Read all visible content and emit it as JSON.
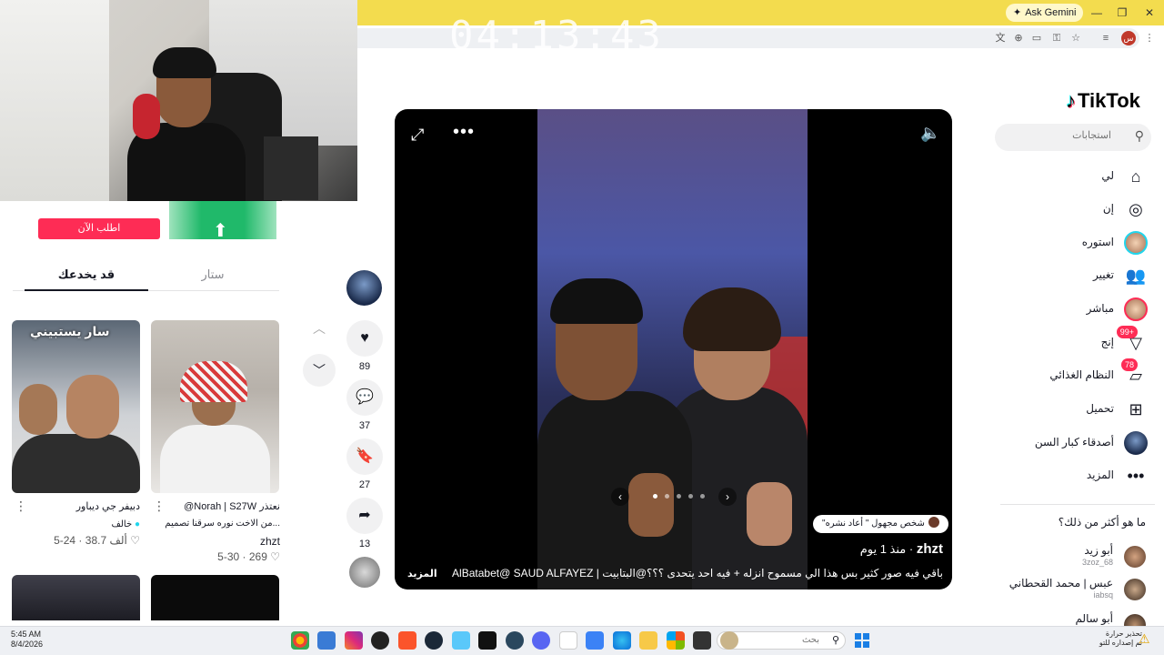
{
  "overlay": {
    "timer": "04:13:43"
  },
  "browser": {
    "ask_gemini": "Ask Gemini",
    "profile_initial": "س",
    "window_controls": [
      "minimize-icon",
      "restore-icon",
      "close-icon"
    ]
  },
  "left_panel": {
    "order_button": "اطلب الآن",
    "tabs": {
      "active": "قد يخدعك",
      "inactive": "ستار"
    },
    "cards": [
      {
        "title": "@Norah | S27W نعتذر",
        "subtitle": "من الاخت نوره سرقنا تصميم...",
        "author": "zhzt",
        "likes": "269",
        "date": "5-30"
      },
      {
        "title": "دبيفر جي ديباور",
        "subtitle": "خالف",
        "author": "",
        "likes": "38.7 ألف",
        "date": "5-24",
        "caption_overlay": "سار يستبيني"
      }
    ]
  },
  "actions": {
    "likes": "89",
    "comments": "37",
    "saves": "27",
    "shares": "13"
  },
  "player": {
    "repost_label": "\"شخص مجهول \" أعاد نشره",
    "author": "zhzt",
    "time_ago": "منذ 1 يوم",
    "caption": "باقي فيه صور كثير بس هذا الي مسموح انزله + فيه احد يتحدى ؟؟؟@البتابيت | AlBatabet@ SAUD ALFAYEZ ...",
    "more": "المزيد",
    "image_count": 5,
    "active_image": 1
  },
  "right_sidebar": {
    "logo": "TikTok",
    "search_placeholder": "استجابات",
    "nav": [
      {
        "label": "لي",
        "icon": "home-icon"
      },
      {
        "label": "إن",
        "icon": "compass-icon"
      },
      {
        "label": "استوره",
        "icon": "story-avatar"
      },
      {
        "label": "تغيير",
        "icon": "following-icon"
      },
      {
        "label": "مباشر",
        "icon": "live-avatar"
      },
      {
        "label": "إنج",
        "icon": "inbox-icon",
        "badge": "99+"
      },
      {
        "label": "النظام الغذائي",
        "icon": "messages-icon",
        "badge": "78"
      },
      {
        "label": "تحميل",
        "icon": "upload-icon"
      },
      {
        "label": "أصدقاء كبار السن",
        "icon": "friends-avatar"
      },
      {
        "label": "المزيد",
        "icon": "more-icon"
      }
    ],
    "suggest_title": "ما هو أكثر من ذلك؟",
    "suggestions": [
      {
        "name": "أبو زيد",
        "handle": "3zoz_68"
      },
      {
        "name": "عبس | محمد القحطاني",
        "handle": "iabsq"
      },
      {
        "name": "أبو سالم",
        "handle": ""
      }
    ]
  },
  "taskbar": {
    "time": "5:45 AM",
    "date": "8/4/2026",
    "search_placeholder": "بحث",
    "weather_line1": "تحذير حرارة",
    "weather_line2": "تم إصداره للتو"
  },
  "colors": {
    "brand": "#fe2c55",
    "titlebar": "#f3dc4e"
  }
}
